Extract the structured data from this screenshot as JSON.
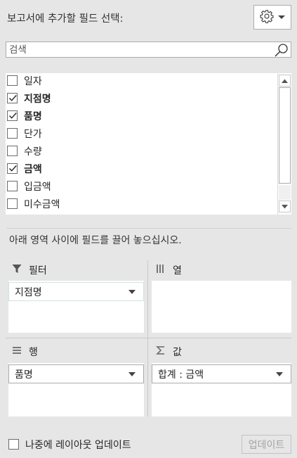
{
  "header": {
    "title": "보고서에 추가할 필드 선택:",
    "tools_icon": "gear-icon"
  },
  "search": {
    "placeholder": "검색",
    "value": ""
  },
  "fields": [
    {
      "label": "일자",
      "checked": false
    },
    {
      "label": "지점명",
      "checked": true
    },
    {
      "label": "품명",
      "checked": true
    },
    {
      "label": "단가",
      "checked": false
    },
    {
      "label": "수량",
      "checked": false
    },
    {
      "label": "금액",
      "checked": true
    },
    {
      "label": "입금액",
      "checked": false
    },
    {
      "label": "미수금액",
      "checked": false
    }
  ],
  "instruction": "아래 영역 사이에 필드를 끌어 놓으십시오.",
  "areas": {
    "filters": {
      "label": "필터",
      "icon": "filter-icon",
      "items": [
        "지점명"
      ]
    },
    "columns": {
      "label": "열",
      "icon": "columns-icon",
      "items": []
    },
    "rows": {
      "label": "행",
      "icon": "rows-icon",
      "items": [
        "품명"
      ]
    },
    "values": {
      "label": "값",
      "icon": "sigma-icon",
      "items": [
        "합계 : 금액"
      ]
    }
  },
  "footer": {
    "defer_label": "나중에 레이아웃 업데이트",
    "defer_checked": false,
    "update_label": "업데이트"
  }
}
